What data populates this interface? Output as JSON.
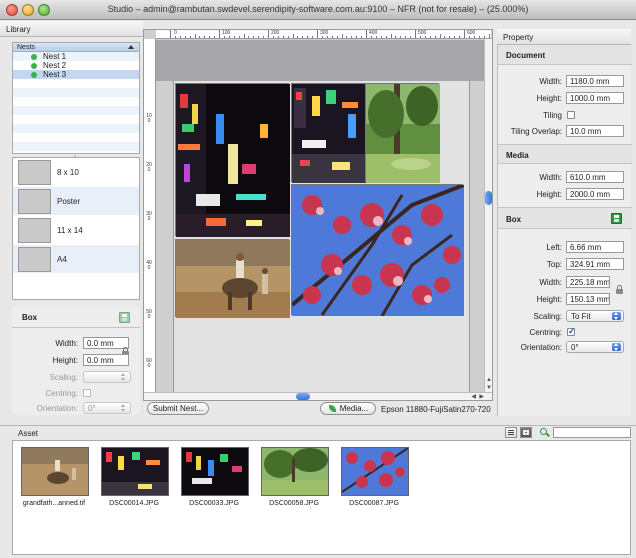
{
  "window": {
    "title": "Studio – admin@rambutan.swdevel.serendipity-software.com.au:9100 – NFR (not for resale) – (25.000%)"
  },
  "library": {
    "title": "Library",
    "nests_header": "Nests",
    "nests": [
      {
        "label": "Nest 1",
        "status_color": "#39b24a"
      },
      {
        "label": "Nest 2",
        "status_color": "#39b24a"
      },
      {
        "label": "Nest 3",
        "status_color": "#39b24a",
        "selected": true
      }
    ],
    "sizes": [
      {
        "label": "8 x 10"
      },
      {
        "label": "Poster"
      },
      {
        "label": "11 x 14"
      },
      {
        "label": "A4"
      }
    ]
  },
  "box_left": {
    "title": "Box",
    "width_label": "Width:",
    "width_value": "0.0 mm",
    "height_label": "Height:",
    "height_value": "0.0 mm",
    "scaling_label": "Scaling:",
    "scaling_value": "",
    "centring_label": "Centring:",
    "orientation_label": "Orientation:",
    "orientation_value": "0°"
  },
  "canvas": {
    "ruler_marks": [
      "0",
      "100",
      "200",
      "300",
      "400",
      "500",
      "600"
    ],
    "ruler_vmarks": [
      "100",
      "200",
      "300",
      "400",
      "500",
      "600",
      "700"
    ],
    "submit_label": "Submit Nest...",
    "media_label": "Media...",
    "printer_label": "Epson 11880-FujiSatin270-720"
  },
  "property": {
    "title": "Property",
    "document": {
      "title": "Document",
      "width_label": "Width:",
      "width_value": "1180.0 mm",
      "height_label": "Height:",
      "height_value": "1000.0 mm",
      "tiling_label": "Tiling",
      "tiling_overlap_label": "Tiling Overlap:",
      "tiling_overlap_value": "10.0 mm"
    },
    "media": {
      "title": "Media",
      "width_label": "Width:",
      "width_value": "610.0 mm",
      "height_label": "Height:",
      "height_value": "2000.0 mm"
    },
    "box": {
      "title": "Box",
      "left_label": "Left:",
      "left_value": "6.66 mm",
      "top_label": "Top:",
      "top_value": "324.91 mm",
      "width_label": "Width:",
      "width_value": "225.18 mm",
      "height_label": "Height:",
      "height_value": "150.13 mm",
      "scaling_label": "Scaling:",
      "scaling_value": "To Fit",
      "centring_label": "Centring:",
      "orientation_label": "Orientation:",
      "orientation_value": "0°"
    }
  },
  "asset": {
    "title": "Asset",
    "search_placeholder": "",
    "items": [
      {
        "name": "grandfath...anned.tif"
      },
      {
        "name": "DSC00014.JPG"
      },
      {
        "name": "DSC00033.JPG"
      },
      {
        "name": "DSC00058.JPG"
      },
      {
        "name": "DSC00087.JPG"
      }
    ]
  },
  "colors": {
    "accent_blue": "#3a72d6",
    "status_green": "#39b24a",
    "selection": "#c3d7f2"
  }
}
